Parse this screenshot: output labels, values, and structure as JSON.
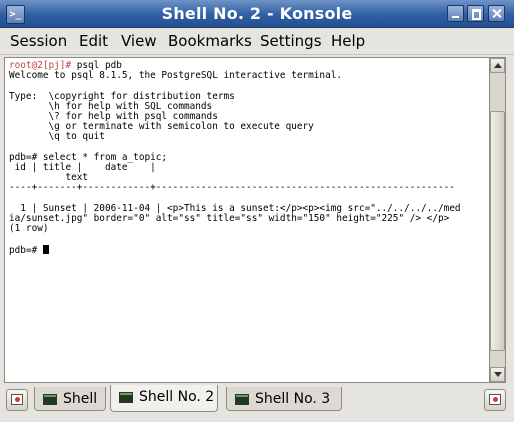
{
  "window": {
    "title": "Shell No. 2 - Konsole",
    "system_button_label": ">_",
    "controls": [
      "minimize",
      "maximize",
      "close"
    ]
  },
  "menu": {
    "items": [
      "Session",
      "Edit",
      "View",
      "Bookmarks",
      "Settings",
      "Help"
    ]
  },
  "terminal": {
    "lines": [
      {
        "prompt": "root@2[pj]# ",
        "text": "psql pdb"
      },
      {
        "prompt": "",
        "text": "Welcome to psql 8.1.5, the PostgreSQL interactive terminal."
      },
      {
        "prompt": "",
        "text": ""
      },
      {
        "prompt": "",
        "text": "Type:  \\copyright for distribution terms"
      },
      {
        "prompt": "",
        "text": "       \\h for help with SQL commands"
      },
      {
        "prompt": "",
        "text": "       \\? for help with psql commands"
      },
      {
        "prompt": "",
        "text": "       \\g or terminate with semicolon to execute query"
      },
      {
        "prompt": "",
        "text": "       \\q to quit"
      },
      {
        "prompt": "",
        "text": ""
      },
      {
        "prompt": "",
        "text": "pdb=# select * from a_topic;"
      },
      {
        "prompt": "",
        "text": " id | title |    date    |"
      },
      {
        "prompt": "",
        "text": "          text"
      },
      {
        "prompt": "",
        "text": "----+-------+------------+-----------------------------------------------------"
      },
      {
        "prompt": "",
        "text": ""
      },
      {
        "prompt": "",
        "text": "  1 | Sunset | 2006-11-04 | <p>This is a sunset:</p><p><img src=\"../../../../med"
      },
      {
        "prompt": "",
        "text": "ia/sunset.jpg\" border=\"0\" alt=\"ss\" title=\"ss\" width=\"150\" height=\"225\" /> </p>"
      },
      {
        "prompt": "",
        "text": "(1 row)"
      },
      {
        "prompt": "",
        "text": ""
      },
      {
        "prompt": "",
        "text": "pdb=# ",
        "cursor": true
      }
    ]
  },
  "tabs": [
    {
      "label": "Shell",
      "active": false
    },
    {
      "label": "Shell No. 2",
      "active": true
    },
    {
      "label": "Shell No. 3",
      "active": false
    }
  ],
  "colors": {
    "titlebar": "#2f5fa4",
    "prompt": "#c34242",
    "background": "#e6e4df"
  }
}
